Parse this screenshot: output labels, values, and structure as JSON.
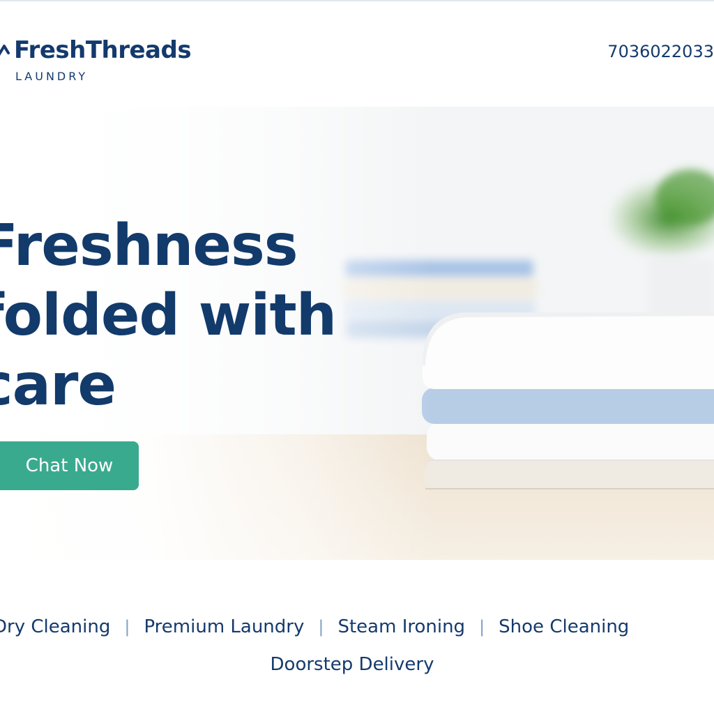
{
  "header": {
    "brand_name": "FreshThreads",
    "brand_subtitle": "LAUNDRY",
    "logo_icon": "hanger-icon",
    "phone": "7036022033"
  },
  "hero": {
    "headline_lines": [
      "Freshness",
      "folded with",
      "care"
    ],
    "cta_label": "Chat Now",
    "image_description_icon": "folded-towels-image"
  },
  "services": {
    "items": [
      "Dry Cleaning",
      "Premium Laundry",
      "Steam Ironing",
      "Shoe Cleaning",
      "Doorstep Delivery"
    ],
    "separator": "|"
  },
  "colors": {
    "brand_navy": "#143a6d",
    "cta_green": "#3aaa8f",
    "separator_blue": "#7fa0c4"
  }
}
